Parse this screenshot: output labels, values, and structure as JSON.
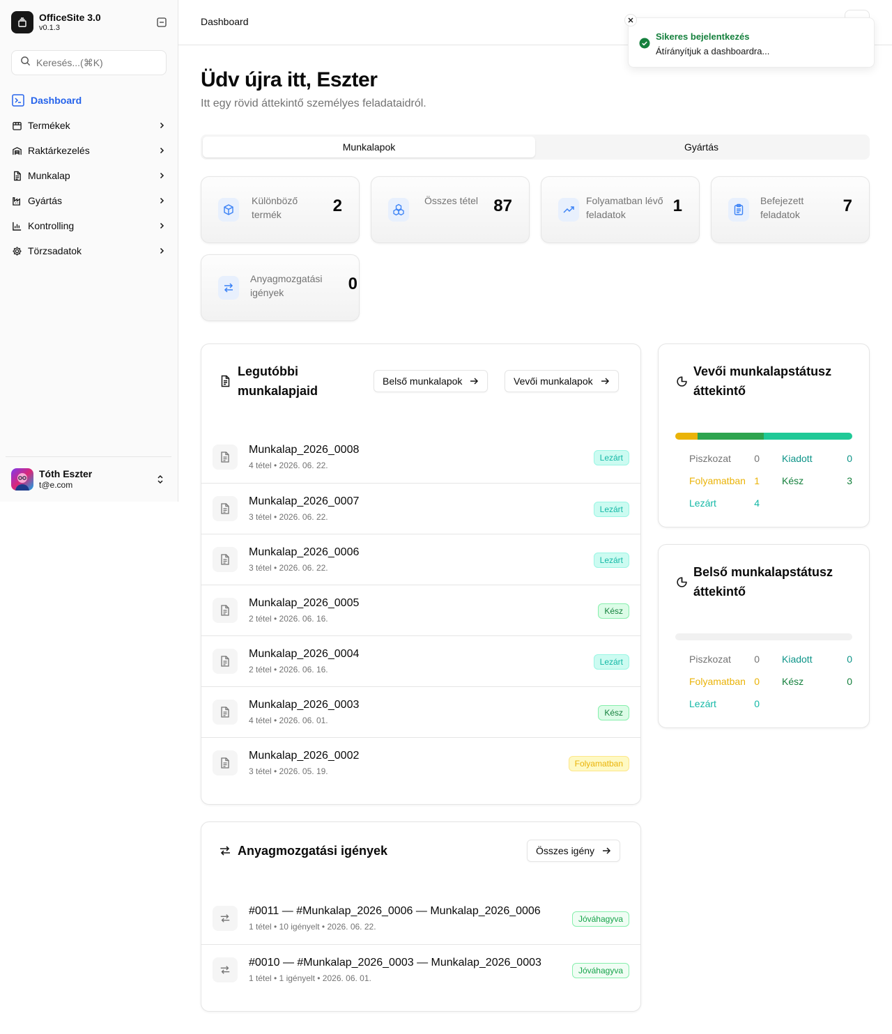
{
  "app": {
    "name": "OfficeSite 3.0",
    "version": "v0.1.3"
  },
  "search": {
    "placeholder": "Keresés...(⌘K)"
  },
  "sidebar": {
    "items": [
      {
        "label": "Dashboard",
        "icon": "terminal-icon"
      },
      {
        "label": "Termékek",
        "icon": "package-icon"
      },
      {
        "label": "Raktárkezelés",
        "icon": "warehouse-icon"
      },
      {
        "label": "Munkalap",
        "icon": "file-text-icon"
      },
      {
        "label": "Gyártás",
        "icon": "factory-icon"
      },
      {
        "label": "Kontrolling",
        "icon": "bar-chart-icon"
      },
      {
        "label": "Törzsadatok",
        "icon": "gear-icon"
      }
    ]
  },
  "user": {
    "name": "Tóth Eszter",
    "email": "t@e.com"
  },
  "header": {
    "breadcrumb": "Dashboard"
  },
  "toast": {
    "title": "Sikeres bejelentkezés",
    "description": "Átírányítjuk a dashboardra..."
  },
  "main": {
    "title": "Üdv újra itt, Eszter",
    "subtitle": "Itt egy rövid áttekintő személyes feladataidról.",
    "tabs": [
      {
        "label": "Munkalapok"
      },
      {
        "label": "Gyártás"
      }
    ]
  },
  "stats": [
    {
      "label": "Különböző termék",
      "value": "2",
      "icon": "box-icon"
    },
    {
      "label": "Összes tétel",
      "value": "87",
      "icon": "boxes-icon"
    },
    {
      "label": "Folyamatban lévő feladatok",
      "value": "1",
      "icon": "trending-up-icon"
    },
    {
      "label": "Befejezett feladatok",
      "value": "7",
      "icon": "clipboard-list-icon"
    },
    {
      "label": "Anyagmozgatási igények",
      "value": "0",
      "icon": "arrows-exchange-icon"
    }
  ],
  "recent": {
    "title": "Legutóbbi munkalapjaid",
    "btn_internal": "Belső munkalapok",
    "btn_customer": "Vevői munkalapok",
    "rows": [
      {
        "title": "Munkalap_2026_0008",
        "meta": "4 tétel • 2026. 06. 22.",
        "status": "Lezárt",
        "kind": "lezart"
      },
      {
        "title": "Munkalap_2026_0007",
        "meta": "3 tétel • 2026. 06. 22.",
        "status": "Lezárt",
        "kind": "lezart"
      },
      {
        "title": "Munkalap_2026_0006",
        "meta": "3 tétel • 2026. 06. 22.",
        "status": "Lezárt",
        "kind": "lezart"
      },
      {
        "title": "Munkalap_2026_0005",
        "meta": "2 tétel • 2026. 06. 16.",
        "status": "Kész",
        "kind": "kesz"
      },
      {
        "title": "Munkalap_2026_0004",
        "meta": "2 tétel • 2026. 06. 16.",
        "status": "Lezárt",
        "kind": "lezart"
      },
      {
        "title": "Munkalap_2026_0003",
        "meta": "4 tétel • 2026. 06. 01.",
        "status": "Kész",
        "kind": "kesz"
      },
      {
        "title": "Munkalap_2026_0002",
        "meta": "3 tétel • 2026. 05. 19.",
        "status": "Folyamatban",
        "kind": "folyamatban"
      }
    ]
  },
  "customer_status": {
    "title": "Vevői munkalapstátusz áttekintő",
    "legend": [
      {
        "label": "Piszkozat",
        "value": "0",
        "color": "#737373"
      },
      {
        "label": "Kiadott",
        "value": "0",
        "color": "#0d9488"
      },
      {
        "label": "Folyamatban",
        "value": "1",
        "color": "#eab308"
      },
      {
        "label": "Kész",
        "value": "3",
        "color": "#15803d"
      },
      {
        "label": "Lezárt",
        "value": "4",
        "color": "#14b8a6"
      }
    ],
    "bar": [
      {
        "label": "Folyamatban",
        "fraction": 0.125,
        "color": "#eab308"
      },
      {
        "label": "Kész",
        "fraction": 0.375,
        "color": "#2ea44f"
      },
      {
        "label": "Lezárt",
        "fraction": 0.5,
        "color": "#20c997"
      }
    ]
  },
  "internal_status": {
    "title": "Belső munkalapstátusz áttekintő",
    "legend": [
      {
        "label": "Piszkozat",
        "value": "0",
        "color": "#737373"
      },
      {
        "label": "Kiadott",
        "value": "0",
        "color": "#0d9488"
      },
      {
        "label": "Folyamatban",
        "value": "0",
        "color": "#eab308"
      },
      {
        "label": "Kész",
        "value": "0",
        "color": "#15803d"
      },
      {
        "label": "Lezárt",
        "value": "0",
        "color": "#14b8a6"
      }
    ],
    "bar": []
  },
  "movements": {
    "title": "Anyagmozgatási igények",
    "btn_all": "Összes igény",
    "rows": [
      {
        "title": "#0011 — #Munkalap_2026_0006 — Munkalap_2026_0006",
        "meta": "1 tétel • 10 igényelt • 2026. 06. 22.",
        "status": "Jóváhagyva"
      },
      {
        "title": "#0010 — #Munkalap_2026_0003 — Munkalap_2026_0003",
        "meta": "1 tétel • 1 igényelt • 2026. 06. 01.",
        "status": "Jóváhagyva"
      }
    ]
  }
}
